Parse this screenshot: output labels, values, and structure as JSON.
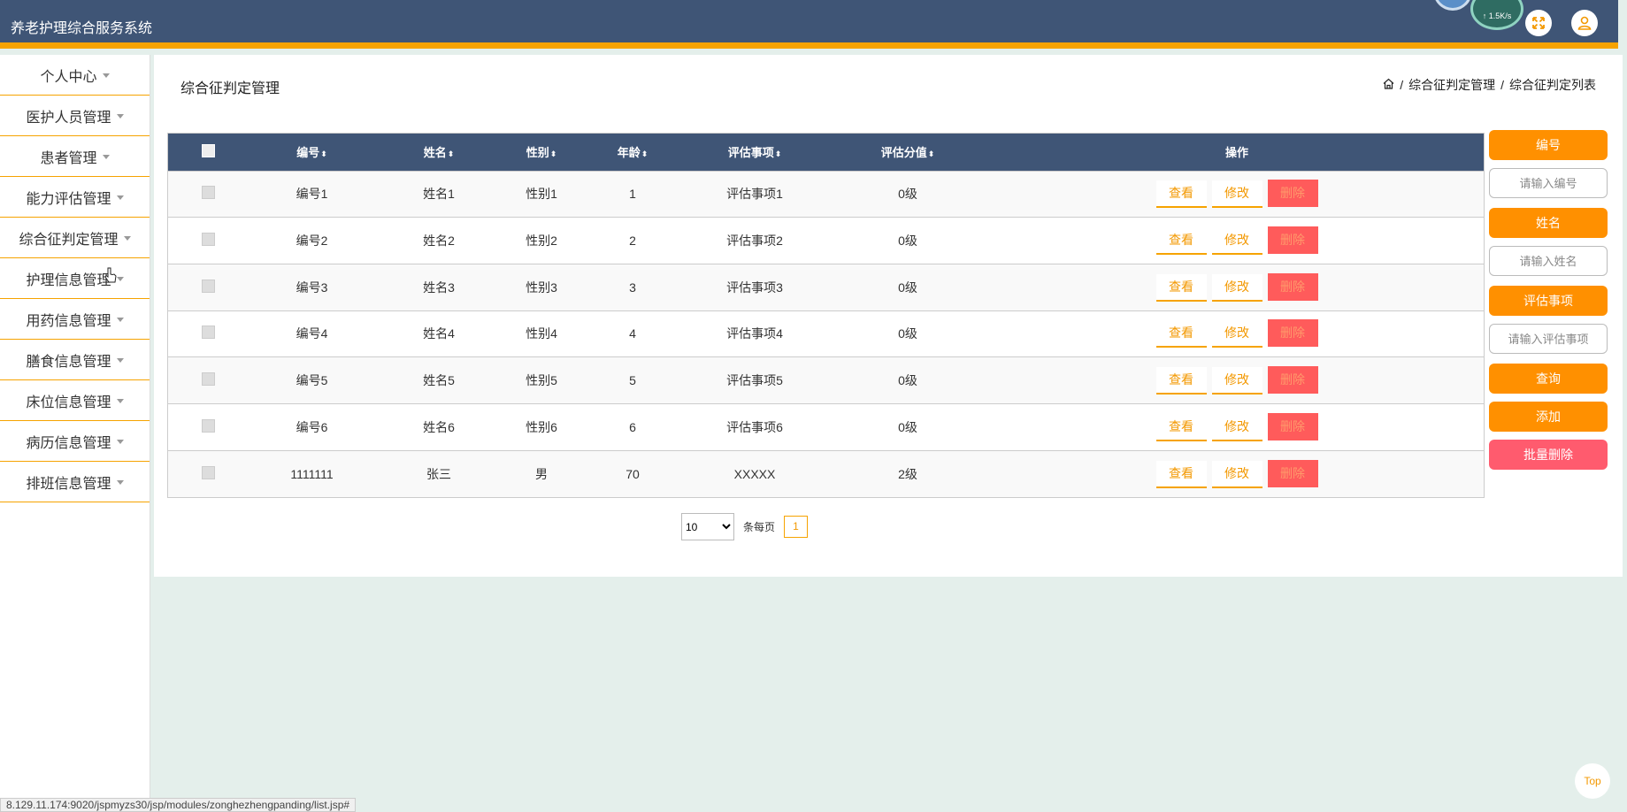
{
  "app": {
    "title": "养老护理综合服务系统"
  },
  "header": {
    "net_speed": "↑ 1.5K/s",
    "fullscreen_icon": "expand-icon",
    "user_icon": "user-icon"
  },
  "sidebar": {
    "items": [
      {
        "label": "个人中心"
      },
      {
        "label": "医护人员管理"
      },
      {
        "label": "患者管理"
      },
      {
        "label": "能力评估管理"
      },
      {
        "label": "综合征判定管理"
      },
      {
        "label": "护理信息管理"
      },
      {
        "label": "用药信息管理"
      },
      {
        "label": "膳食信息管理"
      },
      {
        "label": "床位信息管理"
      },
      {
        "label": "病历信息管理"
      },
      {
        "label": "排班信息管理"
      }
    ]
  },
  "page": {
    "title": "综合征判定管理",
    "breadcrumb": [
      "综合征判定管理",
      "综合征判定列表"
    ]
  },
  "table": {
    "headers": [
      "编号",
      "姓名",
      "性别",
      "年龄",
      "评估事项",
      "评估分值",
      "操作"
    ],
    "actions": {
      "view": "查看",
      "edit": "修改",
      "delete": "删除"
    },
    "rows": [
      [
        "编号1",
        "姓名1",
        "性别1",
        "1",
        "评估事项1",
        "0级"
      ],
      [
        "编号2",
        "姓名2",
        "性别2",
        "2",
        "评估事项2",
        "0级"
      ],
      [
        "编号3",
        "姓名3",
        "性别3",
        "3",
        "评估事项3",
        "0级"
      ],
      [
        "编号4",
        "姓名4",
        "性别4",
        "4",
        "评估事项4",
        "0级"
      ],
      [
        "编号5",
        "姓名5",
        "性别5",
        "5",
        "评估事项5",
        "0级"
      ],
      [
        "编号6",
        "姓名6",
        "性别6",
        "6",
        "评估事项6",
        "0级"
      ],
      [
        "1111111",
        "张三",
        "男",
        "70",
        "XXXXX",
        "2级"
      ]
    ]
  },
  "pager": {
    "page_size": "10",
    "per_page_label": "条每页",
    "current_page": "1"
  },
  "search": {
    "number_label": "编号",
    "number_placeholder": "请输入编号",
    "name_label": "姓名",
    "name_placeholder": "请输入姓名",
    "item_label": "评估事项",
    "item_placeholder": "请输入评估事项",
    "query": "查询",
    "add": "添加",
    "batch_delete": "批量删除"
  },
  "top_button": "Top",
  "status_url": "8.129.11.174:9020/jspmyzs30/jsp/modules/zonghezhengpanding/list.jsp#"
}
